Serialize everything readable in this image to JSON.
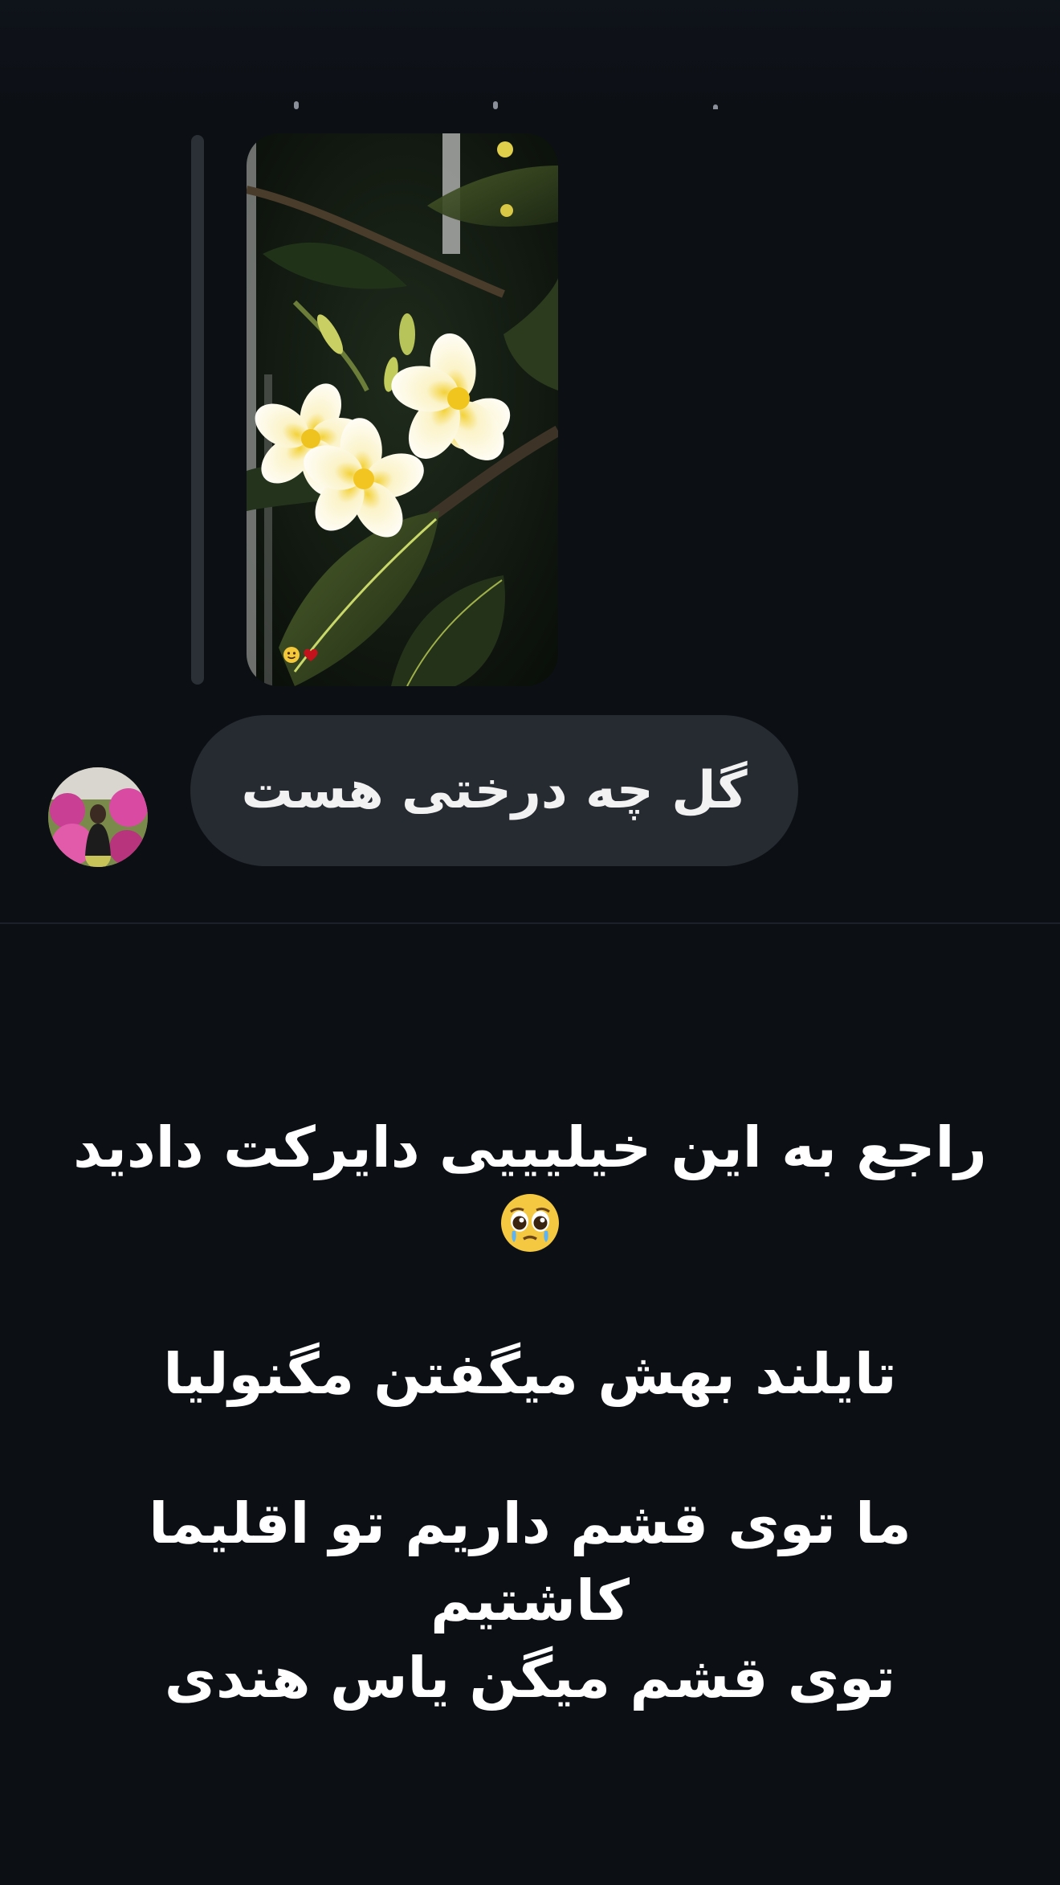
{
  "message": {
    "reply_story": {
      "image_alt": "white frangipani flowers on dark leaves",
      "reaction_icons": [
        "smiling-face-icon",
        "red-heart-icon"
      ]
    },
    "text": "گل چه درختی هست",
    "avatar": {
      "image_alt": "profile photo with pink flowers"
    }
  },
  "caption": {
    "line1": "راجع به این خیلیییی دایرکت دادید",
    "line1_emoji": "pleading-face-icon",
    "line2": "تایلند بهش میگفتن مگنولیا",
    "line3": "ما توی قشم داریم تو اقلیما کاشتیم",
    "line4": "توی قشم میگن یاس هندی"
  },
  "colors": {
    "background": "#0c0f14",
    "bubble": "#262a31",
    "text": "#ffffff"
  }
}
